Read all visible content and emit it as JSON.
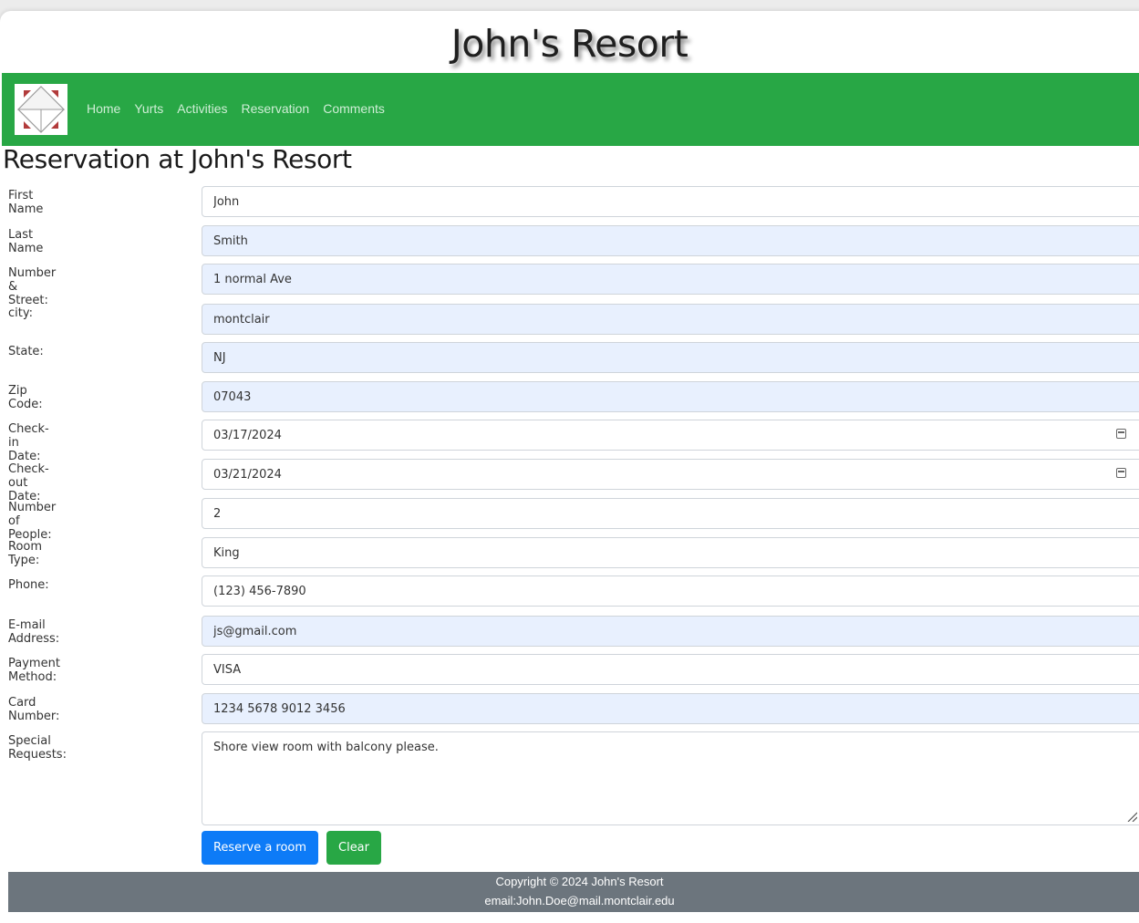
{
  "site": {
    "title": "John's Resort"
  },
  "nav": {
    "items": [
      {
        "label": "Home"
      },
      {
        "label": "Yurts"
      },
      {
        "label": "Activities"
      },
      {
        "label": "Reservation"
      },
      {
        "label": "Comments"
      }
    ]
  },
  "page": {
    "heading": "Reservation at John's Resort"
  },
  "form": {
    "first_name": {
      "label": "First Name",
      "value": "John"
    },
    "last_name": {
      "label": "Last Name",
      "value": "Smith"
    },
    "street": {
      "label": "Number & Street:",
      "value": "1 normal Ave"
    },
    "city": {
      "label": "city:",
      "value": "montclair"
    },
    "state": {
      "label": "State:",
      "value": "NJ"
    },
    "zip": {
      "label": "Zip Code:",
      "value": "07043"
    },
    "checkin": {
      "label": "Check-in Date:",
      "value": "03/17/2024"
    },
    "checkout": {
      "label": "Check-out Date:",
      "value": "03/21/2024"
    },
    "people": {
      "label": "Number of People:",
      "value": "2"
    },
    "room_type": {
      "label": "Room Type:",
      "value": "King"
    },
    "phone": {
      "label": "Phone:",
      "value": "(123) 456-7890"
    },
    "email": {
      "label": "E-mail Address:",
      "value": "js@gmail.com"
    },
    "payment": {
      "label": "Payment Method:",
      "value": "VISA"
    },
    "card": {
      "label": "Card Number:",
      "value": "1234 5678 9012 3456"
    },
    "requests": {
      "label": "Special Requests:",
      "value": "Shore view room with balcony please."
    }
  },
  "buttons": {
    "reserve": "Reserve a room",
    "clear": "Clear"
  },
  "footer": {
    "copyright": "Copyright © 2024 John's Resort",
    "email": "email:John.Doe@mail.montclair.edu"
  },
  "colors": {
    "navbar": "#28a745",
    "primary": "#0d7bf7",
    "success": "#28a745",
    "footer": "#6c757d",
    "autofill": "#e8f0fe"
  },
  "icons": {
    "logo": "cube-logo-icon",
    "calendar": "calendar-icon",
    "resize": "resize-grip-icon"
  }
}
